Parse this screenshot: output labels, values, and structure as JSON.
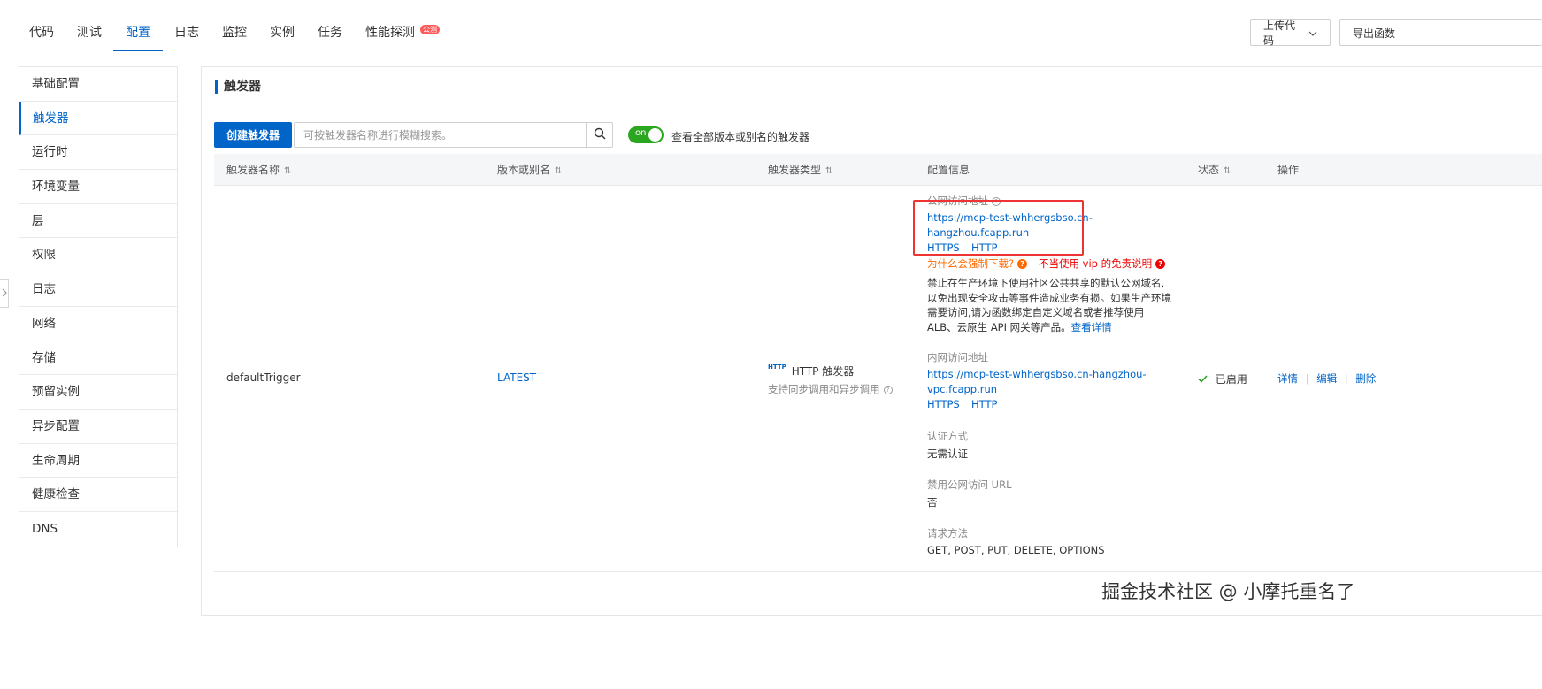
{
  "tabs": [
    {
      "label": "代码"
    },
    {
      "label": "测试"
    },
    {
      "label": "配置"
    },
    {
      "label": "日志"
    },
    {
      "label": "监控"
    },
    {
      "label": "实例"
    },
    {
      "label": "任务"
    },
    {
      "label": "性能探测",
      "badge": "公测"
    }
  ],
  "header_actions": {
    "upload_label": "上传代码",
    "export_label": "导出函数"
  },
  "sidebar": {
    "items": [
      {
        "label": "基础配置"
      },
      {
        "label": "触发器"
      },
      {
        "label": "运行时"
      },
      {
        "label": "环境变量"
      },
      {
        "label": "层"
      },
      {
        "label": "权限"
      },
      {
        "label": "日志"
      },
      {
        "label": "网络"
      },
      {
        "label": "存储"
      },
      {
        "label": "预留实例"
      },
      {
        "label": "异步配置"
      },
      {
        "label": "生命周期"
      },
      {
        "label": "健康检查"
      },
      {
        "label": "DNS"
      }
    ]
  },
  "panel": {
    "title": "触发器",
    "create_button": "创建触发器",
    "search_placeholder": "可按触发器名称进行模糊搜索。",
    "toggle_text": "on",
    "toggle_label": "查看全部版本或别名的触发器"
  },
  "table": {
    "headers": {
      "name": "触发器名称",
      "version": "版本或别名",
      "type": "触发器类型",
      "config": "配置信息",
      "status": "状态",
      "actions": "操作"
    },
    "row": {
      "name": "defaultTrigger",
      "version": "LATEST",
      "type_icon_text": "HTTP",
      "type": "HTTP 触发器",
      "type_desc": "支持同步调用和异步调用",
      "public_label": "公网访问地址",
      "public_url_1": "https://mcp-test-whhergsbso.cn-",
      "public_url_2": "hangzhou.fcapp.run",
      "https_label": "HTTPS",
      "http_label": "HTTP",
      "why_download": "为什么会强制下载?",
      "vip_notice": "不当使用 vip 的免责说明",
      "warning_1": "禁止在生产环境下使用社区公共共享的默认公网域名,",
      "warning_2": "以免出现安全攻击等事件造成业务有损。如果生产环境",
      "warning_3": "需要访问,请为函数绑定自定义域名或者推荐使用",
      "warning_4": "ALB、云原生 API 网关等产品。",
      "see_details": "查看详情",
      "internal_label": "内网访问地址",
      "internal_url_1": "https://mcp-test-whhergsbso.cn-hangzhou-",
      "internal_url_2": "vpc.fcapp.run",
      "auth_label": "认证方式",
      "auth_value": "无需认证",
      "disable_label": "禁用公网访问 URL",
      "disable_value": "否",
      "method_label": "请求方法",
      "method_value": "GET, POST, PUT, DELETE, OPTIONS",
      "status": "已启用",
      "action_detail": "详情",
      "action_edit": "编辑",
      "action_delete": "删除"
    }
  },
  "watermark": "掘金技术社区 @ 小摩托重名了",
  "colors": {
    "accent": "#0064c8",
    "toggle_on": "#2ba620",
    "highlight": "#e33333",
    "warning": "#ff6a00"
  }
}
